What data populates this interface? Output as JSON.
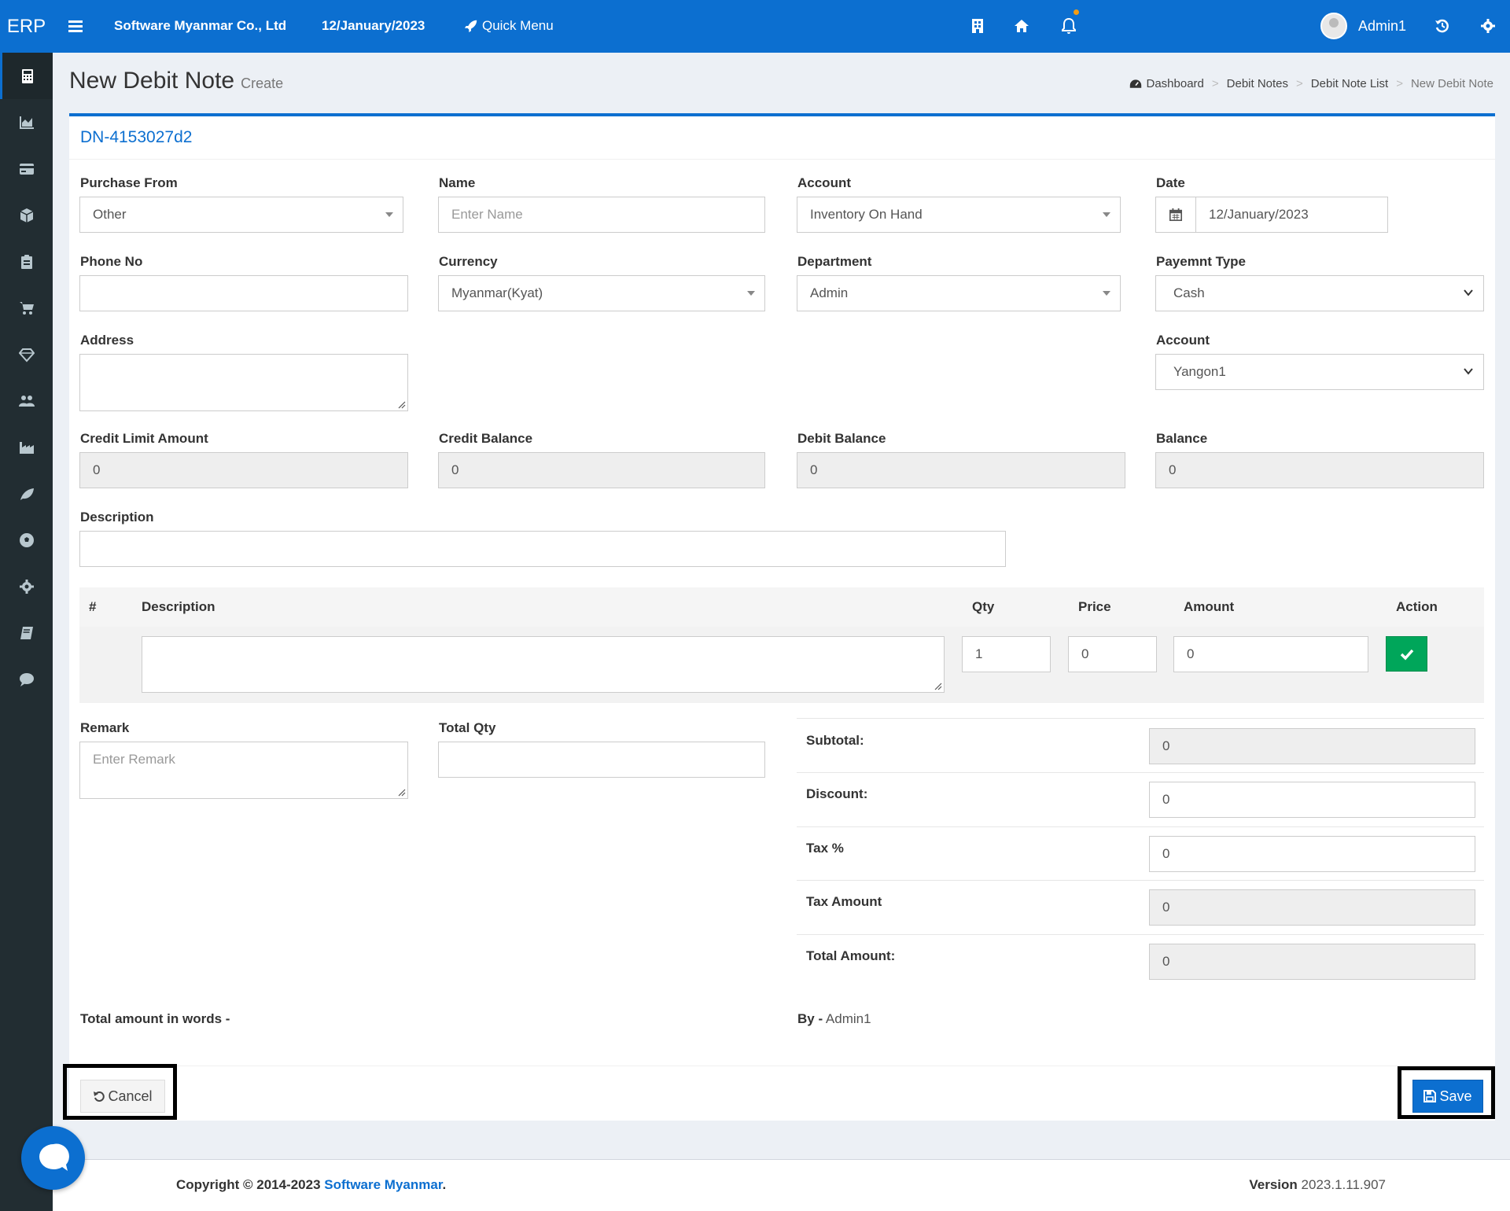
{
  "topbar": {
    "logo": "ERP",
    "company": "Software Myanmar Co., Ltd",
    "date": "12/January/2023",
    "quick_menu": "Quick Menu",
    "user": "Admin1"
  },
  "page": {
    "title": "New Debit Note",
    "subtitle": "Create",
    "breadcrumb": [
      "Dashboard",
      "Debit Notes",
      "Debit Note List",
      "New Debit Note"
    ],
    "doc_no": "DN-4153027d2"
  },
  "form": {
    "purchase_from": {
      "label": "Purchase From",
      "value": "Other"
    },
    "name": {
      "label": "Name",
      "placeholder": "Enter Name"
    },
    "account": {
      "label": "Account",
      "value": "Inventory On Hand"
    },
    "date": {
      "label": "Date",
      "value": "12/January/2023"
    },
    "phone": {
      "label": "Phone No",
      "value": ""
    },
    "currency": {
      "label": "Currency",
      "value": "Myanmar(Kyat)"
    },
    "department": {
      "label": "Department",
      "value": "Admin"
    },
    "payment_type": {
      "label": "Payemnt Type",
      "value": "Cash"
    },
    "address": {
      "label": "Address",
      "value": ""
    },
    "account2": {
      "label": "Account",
      "value": "Yangon1"
    },
    "credit_limit": {
      "label": "Credit Limit Amount",
      "value": "0"
    },
    "credit_balance": {
      "label": "Credit Balance",
      "value": "0"
    },
    "debit_balance": {
      "label": "Debit Balance",
      "value": "0"
    },
    "balance": {
      "label": "Balance",
      "value": "0"
    },
    "description": {
      "label": "Description",
      "value": ""
    }
  },
  "items_table": {
    "headers": [
      "#",
      "Description",
      "Qty",
      "Price",
      "Amount",
      "Action"
    ],
    "row": {
      "qty": "1",
      "price": "0",
      "amount": "0"
    }
  },
  "remark": {
    "label": "Remark",
    "placeholder": "Enter Remark"
  },
  "total_qty": {
    "label": "Total Qty",
    "value": ""
  },
  "totals": {
    "subtotal": {
      "label": "Subtotal:",
      "value": "0"
    },
    "discount": {
      "label": "Discount:",
      "value": "0"
    },
    "tax_pct": {
      "label": "Tax %",
      "value": "0"
    },
    "tax_amount": {
      "label": "Tax Amount",
      "value": "0"
    },
    "total_amount": {
      "label": "Total Amount:",
      "value": "0"
    }
  },
  "words_label": "Total amount in words -",
  "by": {
    "label": "By -",
    "value": "Admin1"
  },
  "buttons": {
    "cancel": "Cancel",
    "save": "Save"
  },
  "footer": {
    "copyright": "Copyright © 2014-2023",
    "company_link": "Software Myanmar",
    "period": ".",
    "version_label": "Version",
    "version": "2023.1.11.907"
  },
  "colors": {
    "primary": "#0c6fd0",
    "sidebar": "#222d32",
    "success": "#00a65a"
  }
}
